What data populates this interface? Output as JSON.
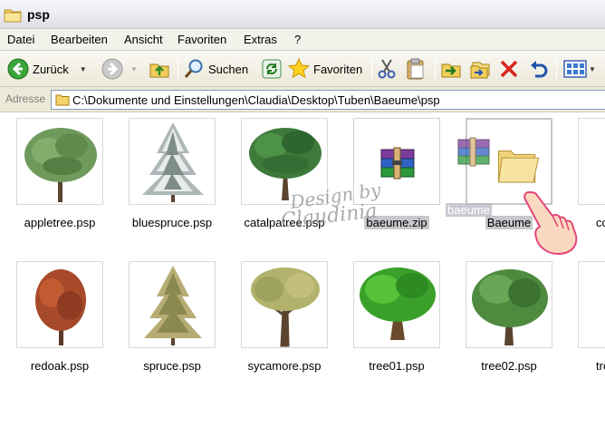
{
  "window": {
    "title": "psp"
  },
  "menu": [
    "Datei",
    "Bearbeiten",
    "Ansicht",
    "Favoriten",
    "Extras",
    "?"
  ],
  "toolbar": {
    "back_label": "Zurück",
    "search_label": "Suchen",
    "favorites_label": "Favoriten"
  },
  "address": {
    "label": "Adresse",
    "path": "C:\\Dokumente und Einstellungen\\Claudia\\Desktop\\Tuben\\Baeume\\psp"
  },
  "files_row1": [
    {
      "name": "appletree.psp"
    },
    {
      "name": "bluespruce.psp"
    },
    {
      "name": "catalpatree.psp"
    },
    {
      "name": "baeume.zip"
    },
    {
      "name": "Baeume"
    }
  ],
  "drag_ghost_label": "baeume",
  "files_row2": [
    {
      "name": "redoak.psp"
    },
    {
      "name": "spruce.psp"
    },
    {
      "name": "sycamore.psp"
    },
    {
      "name": "tree01.psp"
    },
    {
      "name": "tree02.psp"
    }
  ],
  "watermark": {
    "line1": "Design by",
    "line2": "Claudinia"
  },
  "colors": {
    "window_bg": "#ffffff",
    "toolbar_bg": "#ece9d8",
    "selection": "#c8c8cc",
    "address_border": "#7f9db9"
  }
}
